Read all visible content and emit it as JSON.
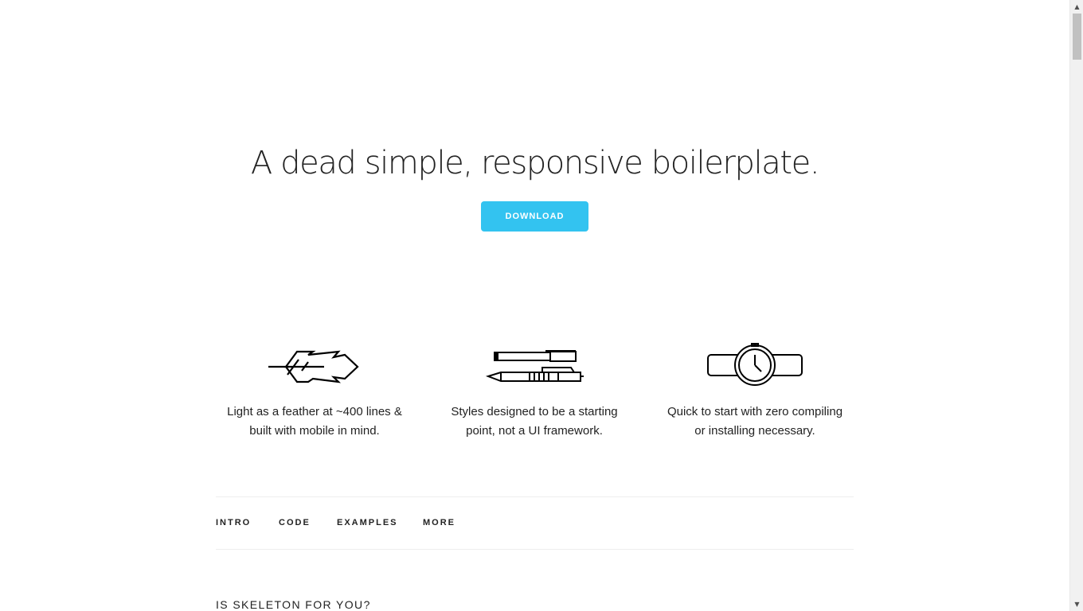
{
  "hero": {
    "heading": "A dead simple, responsive boilerplate.",
    "download_label": "DOWNLOAD",
    "button_color": "#33c3f0"
  },
  "value_props": [
    {
      "icon": "feather-icon",
      "line1": "Light as a feather at ~400 lines &",
      "line2": "built with mobile in mind."
    },
    {
      "icon": "pens-icon",
      "line1": "Styles designed to be a starting",
      "line2": "point, not a UI framework."
    },
    {
      "icon": "watch-icon",
      "line1": "Quick to start with zero compiling",
      "line2": "or installing necessary."
    }
  ],
  "nav": {
    "items": [
      "INTRO",
      "CODE",
      "EXAMPLES",
      "MORE"
    ]
  },
  "section": {
    "title": "IS SKELETON FOR YOU?"
  },
  "scrollbar": {
    "up_icon": "scroll-up-arrow-icon",
    "down_icon": "scroll-down-arrow-icon"
  }
}
